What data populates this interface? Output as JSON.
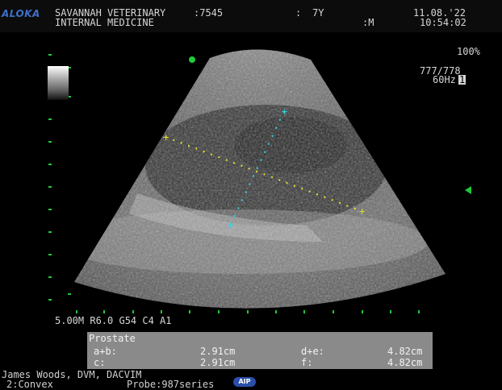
{
  "header": {
    "brand": "ALOKA",
    "clinic": "SAVANNAH VETERINARY",
    "id_label": ":7545",
    "age_label": ":",
    "age": "7Y",
    "date": "11.08.'22",
    "department": "INTERNAL MEDICINE",
    "sex": ":M",
    "time": "10:54:02"
  },
  "right_panel": {
    "zoom": "100%",
    "frame": "777/778",
    "rate": "60Hz",
    "rate_badge": "1"
  },
  "params": "5.00M R6.0 G54 C4 A1",
  "measurement": {
    "title": "Prostate",
    "rows": [
      {
        "label": "a+b:",
        "value": "2.91cm",
        "label2": "d+e:",
        "value2": "4.82cm"
      },
      {
        "label": "c:",
        "value": "2.91cm",
        "label2": "f:",
        "value2": "4.82cm"
      }
    ]
  },
  "footer": {
    "operator": "James Woods, DVM, DACVIM",
    "mode": "2:Convex",
    "probe": "Probe:987series",
    "badge": "AIP"
  },
  "colors": {
    "brand": "#3e6fc9",
    "marker_green": "#1ecb3a",
    "caliper_yellow": "#e8e22a",
    "caliper_cyan": "#35d6e6"
  }
}
